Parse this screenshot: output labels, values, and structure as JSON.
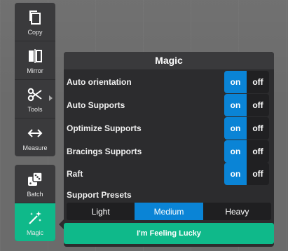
{
  "toolbar": {
    "items": [
      {
        "label": "Copy",
        "icon": "copy-icon"
      },
      {
        "label": "Mirror",
        "icon": "mirror-icon"
      },
      {
        "label": "Tools",
        "icon": "scissors-icon"
      },
      {
        "label": "Measure",
        "icon": "measure-arrows-icon"
      }
    ],
    "group2": [
      {
        "label": "Batch",
        "icon": "dice-icon"
      },
      {
        "label": "Magic",
        "icon": "magic-wand-icon"
      }
    ]
  },
  "panel": {
    "title": "Magic",
    "toggles": [
      {
        "label": "Auto orientation",
        "on": "on",
        "off": "off"
      },
      {
        "label": "Auto Supports",
        "on": "on",
        "off": "off"
      },
      {
        "label": "Optimize Supports",
        "on": "on",
        "off": "off"
      },
      {
        "label": "Bracings Supports",
        "on": "on",
        "off": "off"
      },
      {
        "label": "Raft",
        "on": "on",
        "off": "off"
      }
    ],
    "presets_label": "Support Presets",
    "presets": [
      "Light",
      "Medium",
      "Heavy"
    ],
    "selected_preset": "Medium",
    "lucky_button": "I'm Feeling Lucky"
  },
  "colors": {
    "accent_green": "#0fb98a",
    "accent_blue": "#0a84d6",
    "panel_bg": "#2c2c2e"
  }
}
